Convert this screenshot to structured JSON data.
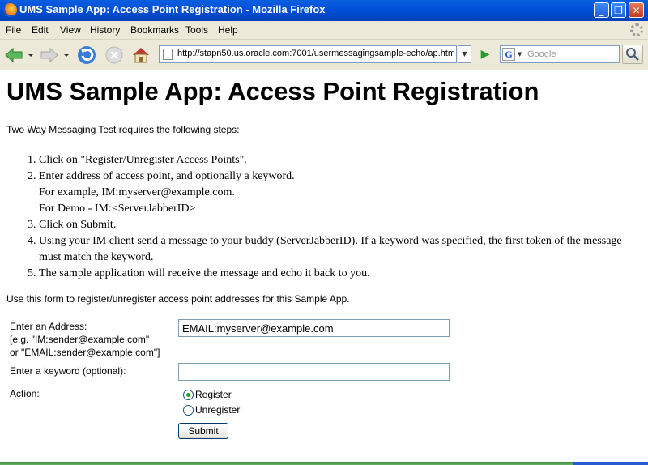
{
  "window": {
    "title": "UMS Sample App: Access Point Registration - Mozilla Firefox",
    "minimize_glyph": "_",
    "maximize_glyph": "❐",
    "close_glyph": "✕"
  },
  "menu": {
    "items": [
      "File",
      "Edit",
      "View",
      "History",
      "Bookmarks",
      "Tools",
      "Help"
    ]
  },
  "toolbar": {
    "url": "http://stapn50.us.oracle.com:7001/usermessagingsample-echo/ap.html",
    "search_engine_glyph": "G",
    "search_placeholder": "Google",
    "icons": [
      "back-arrow-icon",
      "forward-arrow-icon",
      "reload-icon",
      "stop-icon",
      "home-icon",
      "go-arrow-icon",
      "magnifier-icon"
    ]
  },
  "page": {
    "heading": "UMS Sample App: Access Point Registration",
    "intro": "Two Way Messaging Test requires the following steps:",
    "steps": {
      "s1": "Click on \"Register/Unregister Access Points\".",
      "s2_line1": "Enter address of access point, and optionally a keyword.",
      "s2_line2": "For example, IM:myserver@example.com.",
      "s2_line3": "For Demo - IM:<ServerJabberID>",
      "s3": "Click on Submit.",
      "s4": "Using your IM client send a message to your buddy (ServerJabberID). If a keyword was specified, the first token of the message must match the keyword.",
      "s5": "The sample application will receive the message and echo it back to you."
    },
    "form_note": "Use this form to register/unregister access point addresses for this Sample App.",
    "form": {
      "address_label": "Enter an Address:",
      "address_hint1": "[e.g. \"IM:sender@example.com\"",
      "address_hint2": "or \"EMAIL:sender@example.com\"]",
      "address_value": "EMAIL:myserver@example.com",
      "keyword_label": "Enter a keyword (optional):",
      "keyword_value": "",
      "action_label": "Action:",
      "register_label": "Register",
      "unregister_label": "Unregister",
      "selected_action": "Register",
      "submit_label": "Submit"
    }
  }
}
